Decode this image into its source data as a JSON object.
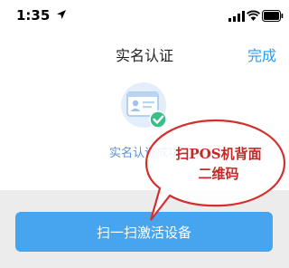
{
  "status_bar": {
    "time": "1:35",
    "icons": [
      "location-arrow-icon",
      "signal-icon",
      "wifi-icon",
      "battery-icon"
    ]
  },
  "nav": {
    "title": "实名认证",
    "action_label": "完成"
  },
  "content": {
    "illustration": "id-card-check-icon",
    "status_text": "实名认证成功"
  },
  "bottom": {
    "button_label": "扫一扫激活设备"
  },
  "annotation": {
    "line1": "扫POS机背面",
    "line2": "二维码",
    "text_color": "#c62828"
  },
  "colors": {
    "accent": "#2d9be8",
    "button_bg": "#47a5ef",
    "success_green": "#3bbf8a",
    "bottom_bg": "#ececec"
  }
}
